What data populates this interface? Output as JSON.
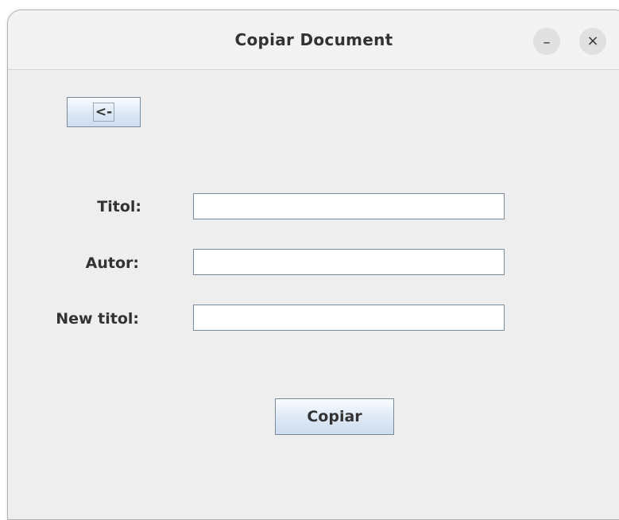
{
  "window": {
    "title": "Copiar Document",
    "minimize_symbol": "–",
    "close_symbol": "×"
  },
  "back_button": {
    "label": "<-"
  },
  "form": {
    "titol_label": "Titol:",
    "titol_value": "",
    "autor_label": "Autor:",
    "autor_value": "",
    "new_titol_label": "New titol:",
    "new_titol_value": ""
  },
  "copy_button": {
    "label": "Copiar"
  },
  "colors": {
    "window_bg": "#eeeeee",
    "titlebar_bg": "#f3f3f3",
    "button_gradient_top": "#fafcff",
    "button_gradient_bottom": "#cdddef",
    "border": "#7a8a99",
    "text": "#333333"
  }
}
